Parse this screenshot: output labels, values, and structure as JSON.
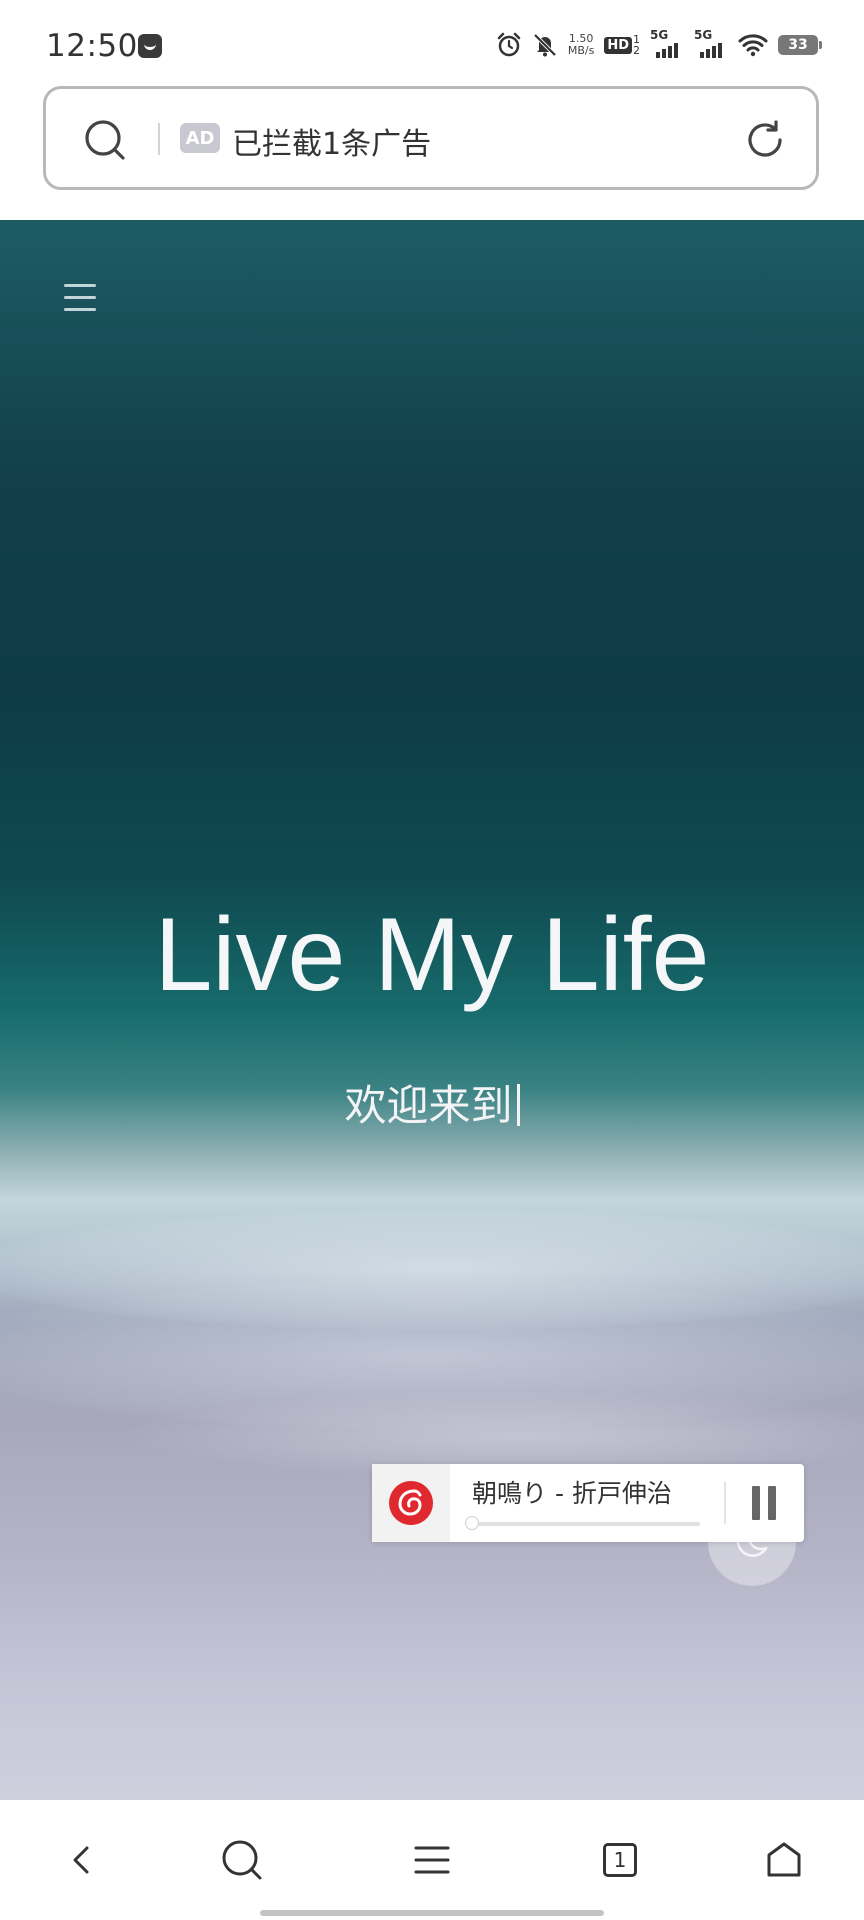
{
  "status_bar": {
    "time": "12:50",
    "net_speed_value": "1.50",
    "net_speed_unit": "MB/s",
    "hd_label": "HD",
    "hd_sub": "1\n2",
    "sim1_label": "5G",
    "sim2_label": "5G",
    "battery": "33",
    "icons": [
      "app-notification-icon",
      "alarm-icon",
      "mute-bell-icon",
      "wifi-icon"
    ]
  },
  "url_bar": {
    "ad_badge": "AD",
    "blocked_text": "已拦截1条广告",
    "icons": [
      "search-icon",
      "reload-icon"
    ]
  },
  "hero": {
    "title": "Live My Life",
    "subtitle": "欢迎来到"
  },
  "player": {
    "track": "朝鳴り - 折戸伸治",
    "progress": 0.0,
    "state": "playing"
  },
  "bottom_nav": {
    "tabs_count": "1",
    "icons": [
      "back-icon",
      "search-icon",
      "menu-icon",
      "tabs-icon",
      "home-icon"
    ]
  },
  "colors": {
    "ocean_deep": "#0e3b45",
    "ocean_shallow": "#176b6c",
    "sand": "#b4b3c6",
    "player_logo_red": "#e0292f"
  }
}
